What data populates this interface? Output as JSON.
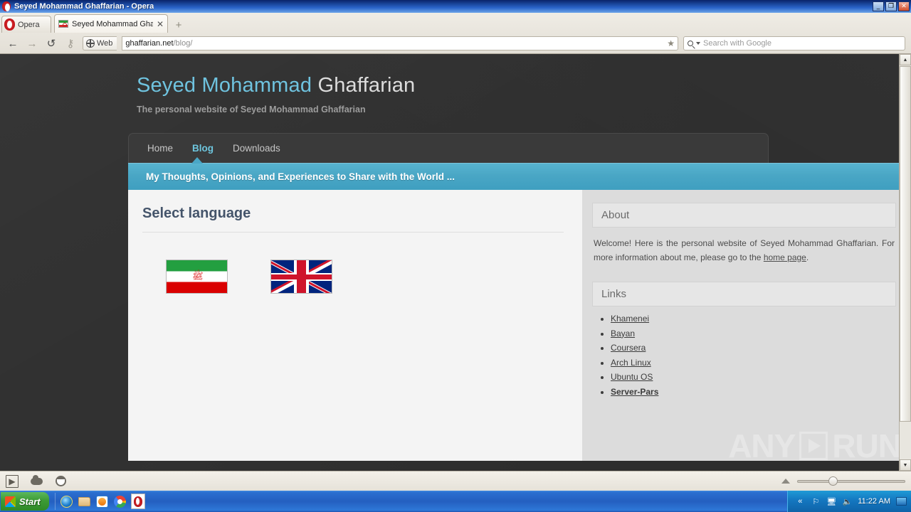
{
  "window": {
    "title": "Seyed Mohammad Ghaffarian - Opera",
    "minimize": "_",
    "restore": "❐",
    "close": "✕"
  },
  "browser": {
    "opera_button": "Opera",
    "tab": {
      "title": "Seyed Mohammad Ghaff...",
      "close": "✕",
      "favicon": "iran-flag-icon"
    },
    "new_tab": "+",
    "nav": {
      "back": "←",
      "forward": "→",
      "reload": "↺",
      "key": "⚷"
    },
    "web_button": "Web",
    "url": {
      "host": "ghaffarian.net",
      "path": "/blog/"
    },
    "bookmark_star": "★",
    "search": {
      "placeholder": "Search with Google",
      "value": ""
    }
  },
  "page": {
    "header": {
      "title_part1": "Seyed Mohammad",
      "title_part2": "Ghaffarian",
      "tagline": "The personal website of Seyed Mohammad Ghaffarian"
    },
    "nav": [
      {
        "label": "Home",
        "active": false
      },
      {
        "label": "Blog",
        "active": true
      },
      {
        "label": "Downloads",
        "active": false
      }
    ],
    "banner": "My Thoughts, Opinions, and Experiences to Share with the World ...",
    "main": {
      "heading": "Select language",
      "flags": [
        {
          "name": "persian-flag",
          "emblem": "الله"
        },
        {
          "name": "english-flag",
          "emblem": ""
        }
      ]
    },
    "sidebar": {
      "about": {
        "title": "About",
        "text_before": "Welcome! Here is the personal website of Seyed Mohammad Ghaffarian. For more information about me, please go to the ",
        "link": "home page",
        "text_after": "."
      },
      "links": {
        "title": "Links",
        "items": [
          {
            "label": "Khamenei",
            "bold": false
          },
          {
            "label": "Bayan",
            "bold": false
          },
          {
            "label": "Coursera",
            "bold": false
          },
          {
            "label": "Arch Linux",
            "bold": false
          },
          {
            "label": "Ubuntu OS",
            "bold": false
          },
          {
            "label": "Server-Pars",
            "bold": true
          }
        ]
      }
    },
    "watermark": {
      "text1": "ANY",
      "text2": "RUN"
    }
  },
  "status_bar": {
    "panels_icon": "panel-toggle-icon",
    "cloud_icon": "cloud-icon",
    "turbo_icon": "opera-turbo-icon",
    "zoom_collapse": "▲"
  },
  "taskbar": {
    "start": "Start",
    "quick_launch": [
      "internet-explorer-icon",
      "folder-icon",
      "media-player-icon",
      "chrome-icon",
      "opera-icon"
    ],
    "tray": {
      "chevron": "«",
      "flag_icon": "flag-icon",
      "network_icon": "network-icon",
      "volume_icon": "🔊",
      "clock": "11:22 AM",
      "screen_icon": "monitor-icon"
    }
  },
  "colors": {
    "accent_banner": "#49a6c5",
    "nav_active": "#6ec6de",
    "page_bg": "#2e2e2e",
    "content_bg": "#f4f4f4",
    "sidebar_bg": "#dcdcdc",
    "heading": "#44546a"
  }
}
